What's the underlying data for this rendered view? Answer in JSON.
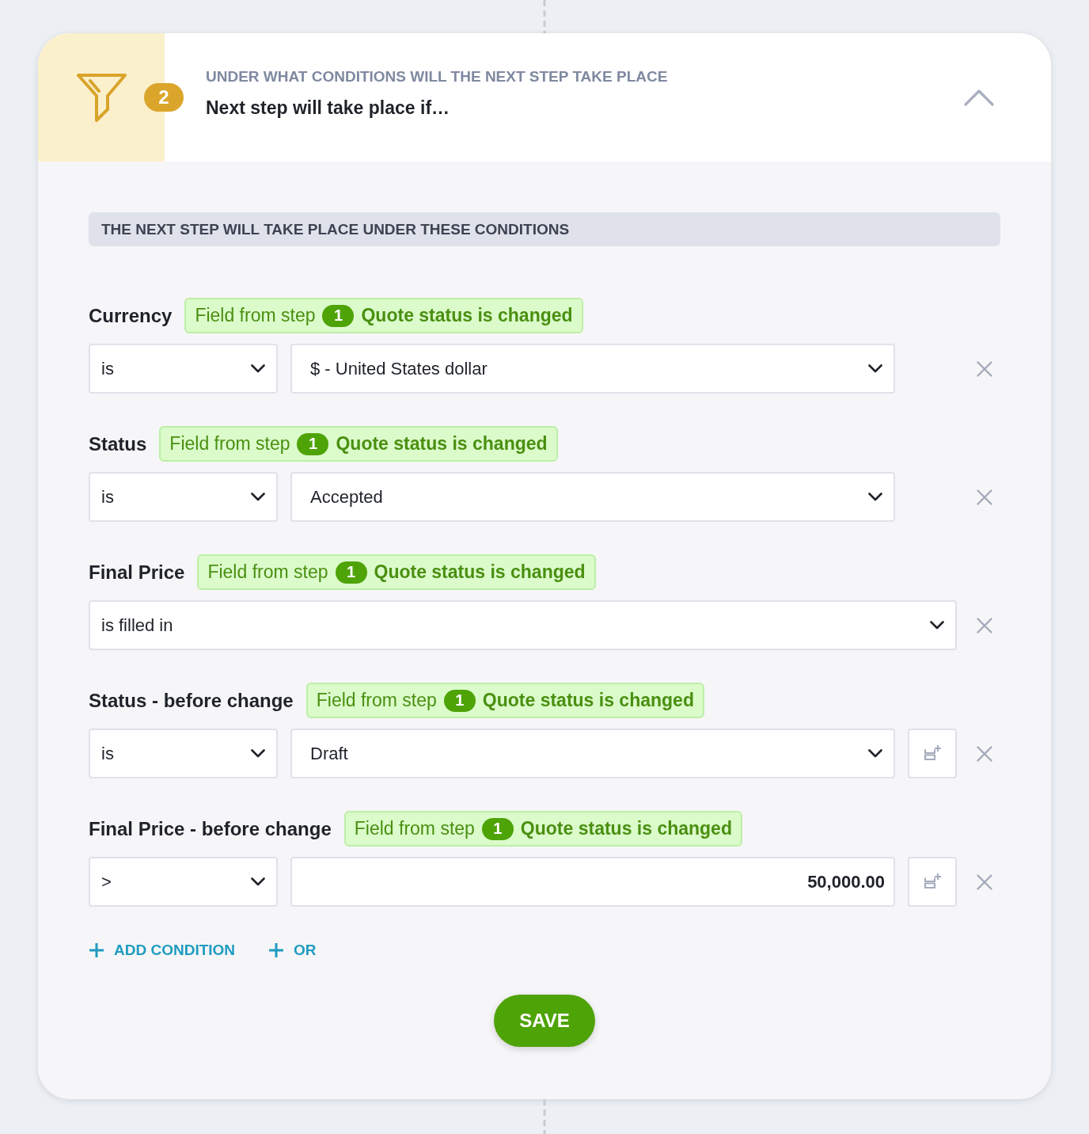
{
  "header": {
    "step": "2",
    "overline": "UNDER WHAT CONDITIONS WILL THE NEXT STEP TAKE PLACE",
    "title": "Next step will take place if…",
    "expanded": true
  },
  "section_heading": "THE NEXT STEP WILL TAKE PLACE UNDER THESE CONDITIONS",
  "conditions": [
    {
      "label": "Currency",
      "source": {
        "prefix": "Field from step",
        "step": "1",
        "name": "Quote status is changed"
      },
      "kind": "select",
      "operator": "is",
      "value": "$ - United States dollar",
      "variable_button": false
    },
    {
      "label": "Status",
      "source": {
        "prefix": "Field from step",
        "step": "1",
        "name": "Quote status is changed"
      },
      "kind": "select",
      "operator": "is",
      "value": "Accepted",
      "variable_button": false
    },
    {
      "label": "Final Price",
      "source": {
        "prefix": "Field from step",
        "step": "1",
        "name": "Quote status is changed"
      },
      "kind": "operator",
      "operator": "is filled in",
      "variable_button": false
    },
    {
      "label": "Status - before change",
      "source": {
        "prefix": "Field from step",
        "step": "1",
        "name": "Quote status is changed"
      },
      "kind": "select",
      "operator": "is",
      "value": "Draft",
      "variable_button": true
    },
    {
      "label": "Final Price - before change",
      "source": {
        "prefix": "Field from step",
        "step": "1",
        "name": "Quote status is changed"
      },
      "kind": "number",
      "operator": ">",
      "value": "50,000.00",
      "variable_button": true
    }
  ],
  "actions": [
    {
      "label": "ADD CONDITION"
    },
    {
      "label": "OR"
    }
  ],
  "save_button": "SAVE"
}
